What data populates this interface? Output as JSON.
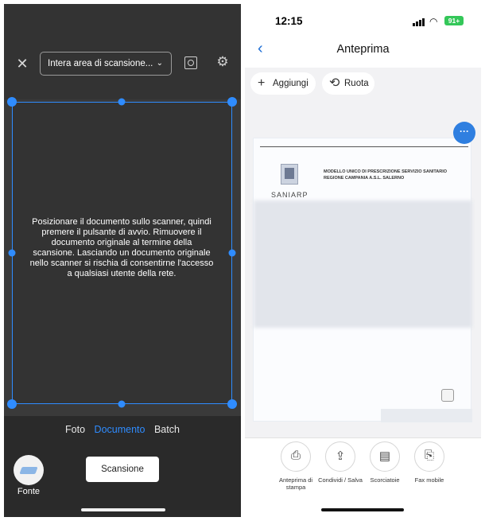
{
  "left": {
    "top": {
      "close_icon": "close-icon",
      "area_select": "Intera area di scansione...",
      "preview_icon": "preview-icon",
      "gear_icon": "gear-icon"
    },
    "scan_message": "Posizionare il documento sullo scanner, quindi premere il pulsante di avvio. Rimuovere il documento originale al termine della scansione. Lasciando un documento originale nello scanner si rischia di consentirne l'accesso a qualsiasi utente della rete.",
    "modes": [
      "Foto",
      "Documento",
      "Batch"
    ],
    "active_mode": "Documento",
    "source_label": "Fonte",
    "scan_button": "Scansione",
    "accent_color": "#2f8cff"
  },
  "right": {
    "status": {
      "time": "12:15",
      "battery": "91+"
    },
    "nav": {
      "title": "Anteprima"
    },
    "actions": {
      "add": "Aggiungi",
      "rotate": "Ruota"
    },
    "document": {
      "header_line1": "MODELLO UNICO DI PRESCRIZIONE SERVIZIO SANITARIO",
      "header_line2": "REGIONE CAMPANIA A.S.L. SALERNO",
      "brand": "SANIARP"
    },
    "tools": [
      {
        "icon": "printer-icon",
        "label": "Anteprima di stampa"
      },
      {
        "icon": "share-icon",
        "label": "Condividi / Salva"
      },
      {
        "icon": "shortcut-icon",
        "label": "Scorciatoie"
      },
      {
        "icon": "fax-icon",
        "label": "Fax mobile"
      }
    ]
  }
}
